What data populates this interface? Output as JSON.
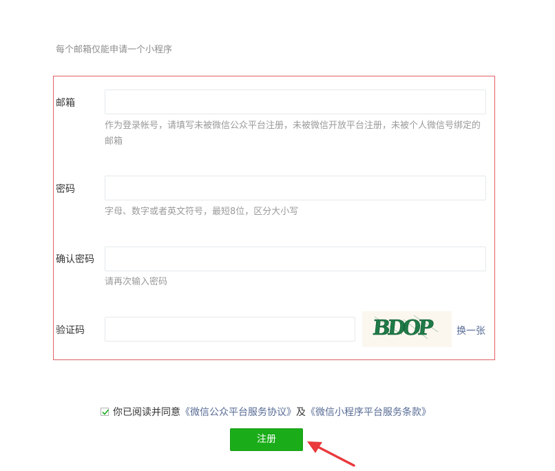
{
  "notice": "每个邮箱仅能申请一个小程序",
  "form": {
    "email": {
      "label": "邮箱",
      "value": "",
      "hint": "作为登录帐号，请填写未被微信公众平台注册，未被微信开放平台注册，未被个人微信号绑定的邮箱"
    },
    "password": {
      "label": "密码",
      "value": "",
      "hint": "字母、数字或者英文符号，最短8位，区分大小写"
    },
    "confirm_password": {
      "label": "确认密码",
      "value": "",
      "hint": "请再次输入密码"
    },
    "captcha": {
      "label": "验证码",
      "value": "",
      "image_text": "BDOP",
      "refresh_label": "换一张"
    }
  },
  "agreement": {
    "checked": true,
    "prefix": "你已阅读并同意",
    "link1": "《微信公众平台服务协议》",
    "conjunction": "及",
    "link2": "《微信小程序平台服务条款》"
  },
  "submit_label": "注册",
  "colors": {
    "accent_green": "#1aad19",
    "error_border": "#e15f63",
    "link": "#576b95",
    "annotation_arrow": "#e9393c"
  }
}
